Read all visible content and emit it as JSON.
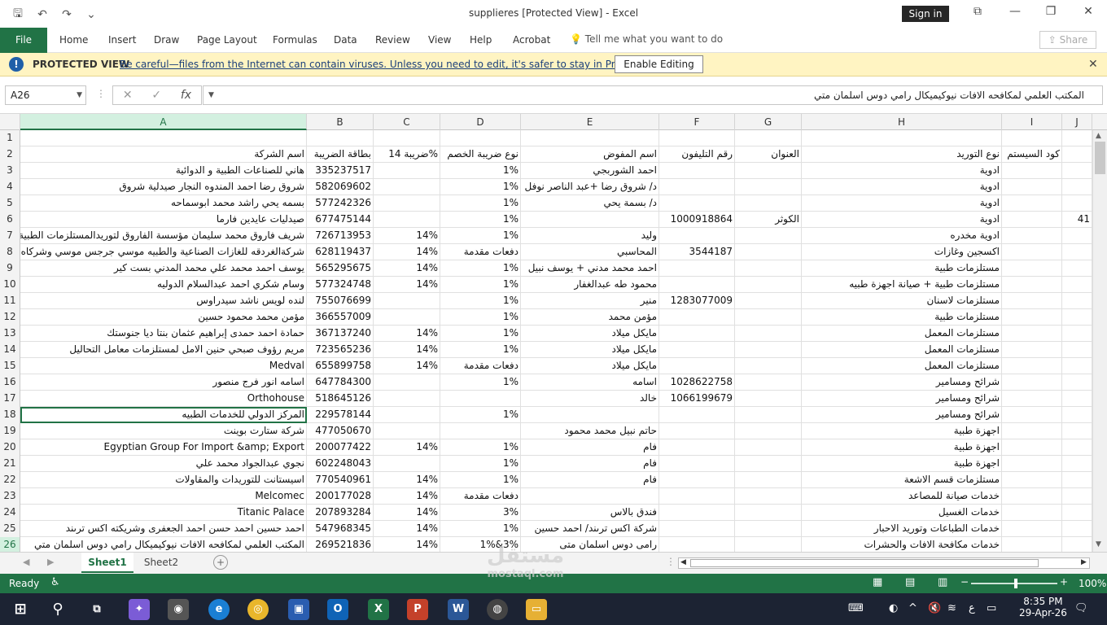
{
  "window": {
    "title": "supplieres  [Protected View]  -  Excel",
    "sign_in": "Sign in"
  },
  "ribbon": {
    "file": "File",
    "tabs": [
      "Home",
      "Insert",
      "Draw",
      "Page Layout",
      "Formulas",
      "Data",
      "Review",
      "View",
      "Help",
      "Acrobat"
    ],
    "tell_me": "Tell me what you want to do",
    "share": "Share"
  },
  "protected_view": {
    "title": "PROTECTED VIEW",
    "message": "Be careful—files from the Internet can contain viruses. Unless you need to edit, it's safer to stay in Protected View.",
    "button": "Enable Editing"
  },
  "formula_bar": {
    "name_box": "A26",
    "content": "المكتب العلمي لمكافحه الافات نيوكيميكال رامي دوس اسلمان متي"
  },
  "columns": [
    "A",
    "B",
    "C",
    "D",
    "E",
    "F",
    "G",
    "H",
    "I",
    "J"
  ],
  "rows": [
    {
      "n": "1",
      "a": "",
      "b": "",
      "c": "",
      "d": "",
      "e": "",
      "f": "",
      "g": "",
      "h": "",
      "i": "",
      "j": ""
    },
    {
      "n": "2",
      "a": "اسم الشركة",
      "b": "بطاقة الضريبة",
      "c": "ضريبة 14%",
      "d": "نوع ضريبة الخصم",
      "e": "اسم المفوض",
      "f": "رقم التليفون",
      "g": "العنوان",
      "h": "نوع التوريد",
      "i": "كود السيستم",
      "j": ""
    },
    {
      "n": "3",
      "a": "هاني للصناعات الطبية و الدوائية",
      "b": "335237517",
      "c": "",
      "d": "1%",
      "e": "احمد الشوربجي",
      "f": "",
      "g": "",
      "h": "ادوية",
      "i": "",
      "j": ""
    },
    {
      "n": "4",
      "a": "شروق رضا احمد المندوه النجار صيدلية شروق",
      "b": "582069602",
      "c": "",
      "d": "1%",
      "e": "د/ شروق رضا +عبد الناصر نوفل",
      "f": "",
      "g": "",
      "h": "ادوية",
      "i": "",
      "j": ""
    },
    {
      "n": "5",
      "a": "بسمه يحي راشد محمد ابوسماحه",
      "b": "577242326",
      "c": "",
      "d": "1%",
      "e": "د/ بسمة يحي",
      "f": "",
      "g": "",
      "h": "ادوية",
      "i": "",
      "j": ""
    },
    {
      "n": "6",
      "a": "صيدليات عايدين فارما",
      "b": "677475144",
      "c": "",
      "d": "1%",
      "e": "",
      "f": "1000918864",
      "g": "الكوثر",
      "h": "ادوية",
      "i": "",
      "j": "41"
    },
    {
      "n": "7",
      "a": "شريف فاروق محمد سليمان مؤسسة الفاروق لتوريدالمستلزمات الطبية",
      "b": "726713953",
      "c": "14%",
      "d": "1%",
      "e": "وليد",
      "f": "",
      "g": "",
      "h": "ادوية مخدره",
      "i": "",
      "j": ""
    },
    {
      "n": "8",
      "a": "شركةالغردقه للغازات الصناعية والطبيه موسي جرجس موسي وشركاه",
      "b": "628119437",
      "c": "14%",
      "d": "دفعات مقدمة",
      "e": "المحاسبي",
      "f": "3544187",
      "g": "",
      "h": "اكسجين وغازات",
      "i": "",
      "j": ""
    },
    {
      "n": "9",
      "a": "يوسف احمد محمد علي محمد المدني بست كير",
      "b": "565295675",
      "c": "14%",
      "d": "1%",
      "e": "احمد محمد  مدني + يوسف نبيل",
      "f": "",
      "g": "",
      "h": "مستلزمات طبية",
      "i": "",
      "j": ""
    },
    {
      "n": "10",
      "a": "وسام شكري احمد عبدالسلام الدوليه",
      "b": "577324748",
      "c": "14%",
      "d": "1%",
      "e": "محمود طه عبدالغفار",
      "f": "",
      "g": "",
      "h": "مستلزمات طبية + صيانة اجهزة طبيه",
      "i": "",
      "j": ""
    },
    {
      "n": "11",
      "a": "لنده لويس ناشد سيدراوس",
      "b": "755076699",
      "c": "",
      "d": "1%",
      "e": "منير",
      "f": "1283077009",
      "g": "",
      "h": "مستلزمات لاسنان",
      "i": "",
      "j": ""
    },
    {
      "n": "12",
      "a": "مؤمن محمد محمود حسين",
      "b": "366557009",
      "c": "",
      "d": "1%",
      "e": "مؤمن محمد",
      "f": "",
      "g": "",
      "h": "مستلزمات طبية",
      "i": "",
      "j": ""
    },
    {
      "n": "13",
      "a": "حمادة احمد حمدى إبراهيم عثمان    بنتا ديا جنوستك",
      "b": "367137240",
      "c": "14%",
      "d": "1%",
      "e": "مايكل ميلاد",
      "f": "",
      "g": "",
      "h": "مستلزمات المعمل",
      "i": "",
      "j": ""
    },
    {
      "n": "14",
      "a": "مريم رؤوف صبحي حنين  الامل لمستلزمات معامل التحاليل",
      "b": "723565236",
      "c": "14%",
      "d": "1%",
      "e": "مايكل ميلاد",
      "f": "",
      "g": "",
      "h": "مستلزمات المعمل",
      "i": "",
      "j": ""
    },
    {
      "n": "15",
      "a": "Medval",
      "b": "655899758",
      "c": "14%",
      "d": "دفعات مقدمة",
      "e": "مايكل ميلاد",
      "f": "",
      "g": "",
      "h": "مستلزمات المعمل",
      "i": "",
      "j": ""
    },
    {
      "n": "16",
      "a": "اسامه انور فرج منصور",
      "b": "647784300",
      "c": "",
      "d": "1%",
      "e": "اسامه",
      "f": "1028622758",
      "g": "",
      "h": "شرائح ومسامير",
      "i": "",
      "j": ""
    },
    {
      "n": "17",
      "a": "Orthohouse",
      "b": "518645126",
      "c": "",
      "d": "",
      "e": "خالد",
      "f": "1066199679",
      "g": "",
      "h": "شرائح ومسامير",
      "i": "",
      "j": ""
    },
    {
      "n": "18",
      "a": "المركز الدولي للخدمات الطبيه",
      "b": "229578144",
      "c": "",
      "d": "1%",
      "e": "",
      "f": "",
      "g": "",
      "h": "شرائح ومسامير",
      "i": "",
      "j": ""
    },
    {
      "n": "19",
      "a": "شركة ستارت بوينت",
      "b": "477050670",
      "c": "",
      "d": "",
      "e": "حاتم نبيل محمد محمود",
      "f": "",
      "g": "",
      "h": "اجهزة طبية",
      "i": "",
      "j": ""
    },
    {
      "n": "20",
      "a": "Egyptian Group For Import &amp; Export",
      "b": "200077422",
      "c": "14%",
      "d": "1%",
      "e": "فام",
      "f": "",
      "g": "",
      "h": "اجهزة طبية",
      "i": "",
      "j": ""
    },
    {
      "n": "21",
      "a": "نجوي عبدالجواد محمد علي",
      "b": "602248043",
      "c": "",
      "d": "1%",
      "e": "فام",
      "f": "",
      "g": "",
      "h": "اجهزة طبية",
      "i": "",
      "j": ""
    },
    {
      "n": "22",
      "a": "اسيستانت للتوريدات والمقاولات",
      "b": "770540961",
      "c": "14%",
      "d": "1%",
      "e": "فام",
      "f": "",
      "g": "",
      "h": "مستلزمات قسم الاشعة",
      "i": "",
      "j": ""
    },
    {
      "n": "23",
      "a": "Melcomec",
      "b": "200177028",
      "c": "14%",
      "d": "دفعات مقدمة",
      "e": "",
      "f": "",
      "g": "",
      "h": "خدمات صيانة  للمصاعد",
      "i": "",
      "j": ""
    },
    {
      "n": "24",
      "a": "Titanic Palace",
      "b": "207893284",
      "c": "14%",
      "d": "3%",
      "e": "فندق بالاس",
      "f": "",
      "g": "",
      "h": "خدمات الغسيل",
      "i": "",
      "j": ""
    },
    {
      "n": "25",
      "a": "احمد حسين احمد حسن احمد الجعفرى وشريكته اكس ترىند",
      "b": "547968345",
      "c": "14%",
      "d": "1%",
      "e": "شركة اكس ترىند/ احمد حسين",
      "f": "",
      "g": "",
      "h": "خدمات الطباعات وتوريد الاحبار",
      "i": "",
      "j": ""
    },
    {
      "n": "26",
      "a": "المكتب العلمي لمكافحه الافات نيوكيميكال رامي دوس اسلمان متي",
      "b": "269521836",
      "c": "14%",
      "d": "1%&3%",
      "e": "رامى دوس اسلمان متى",
      "f": "",
      "g": "",
      "h": "خدمات  مكافحة الافات  والحشرات",
      "i": "",
      "j": ""
    }
  ],
  "sheets": [
    "Sheet1",
    "Sheet2"
  ],
  "status": {
    "ready": "Ready",
    "zoom": "100%"
  },
  "taskbar": {
    "time": "8:35 PM",
    "date": "29-Apr-26",
    "lang": "ع"
  },
  "watermark": "مستقل",
  "watermark_url": "mostaql.com",
  "colors": {
    "excel_green": "#217346",
    "banner": "#fff4c2"
  }
}
